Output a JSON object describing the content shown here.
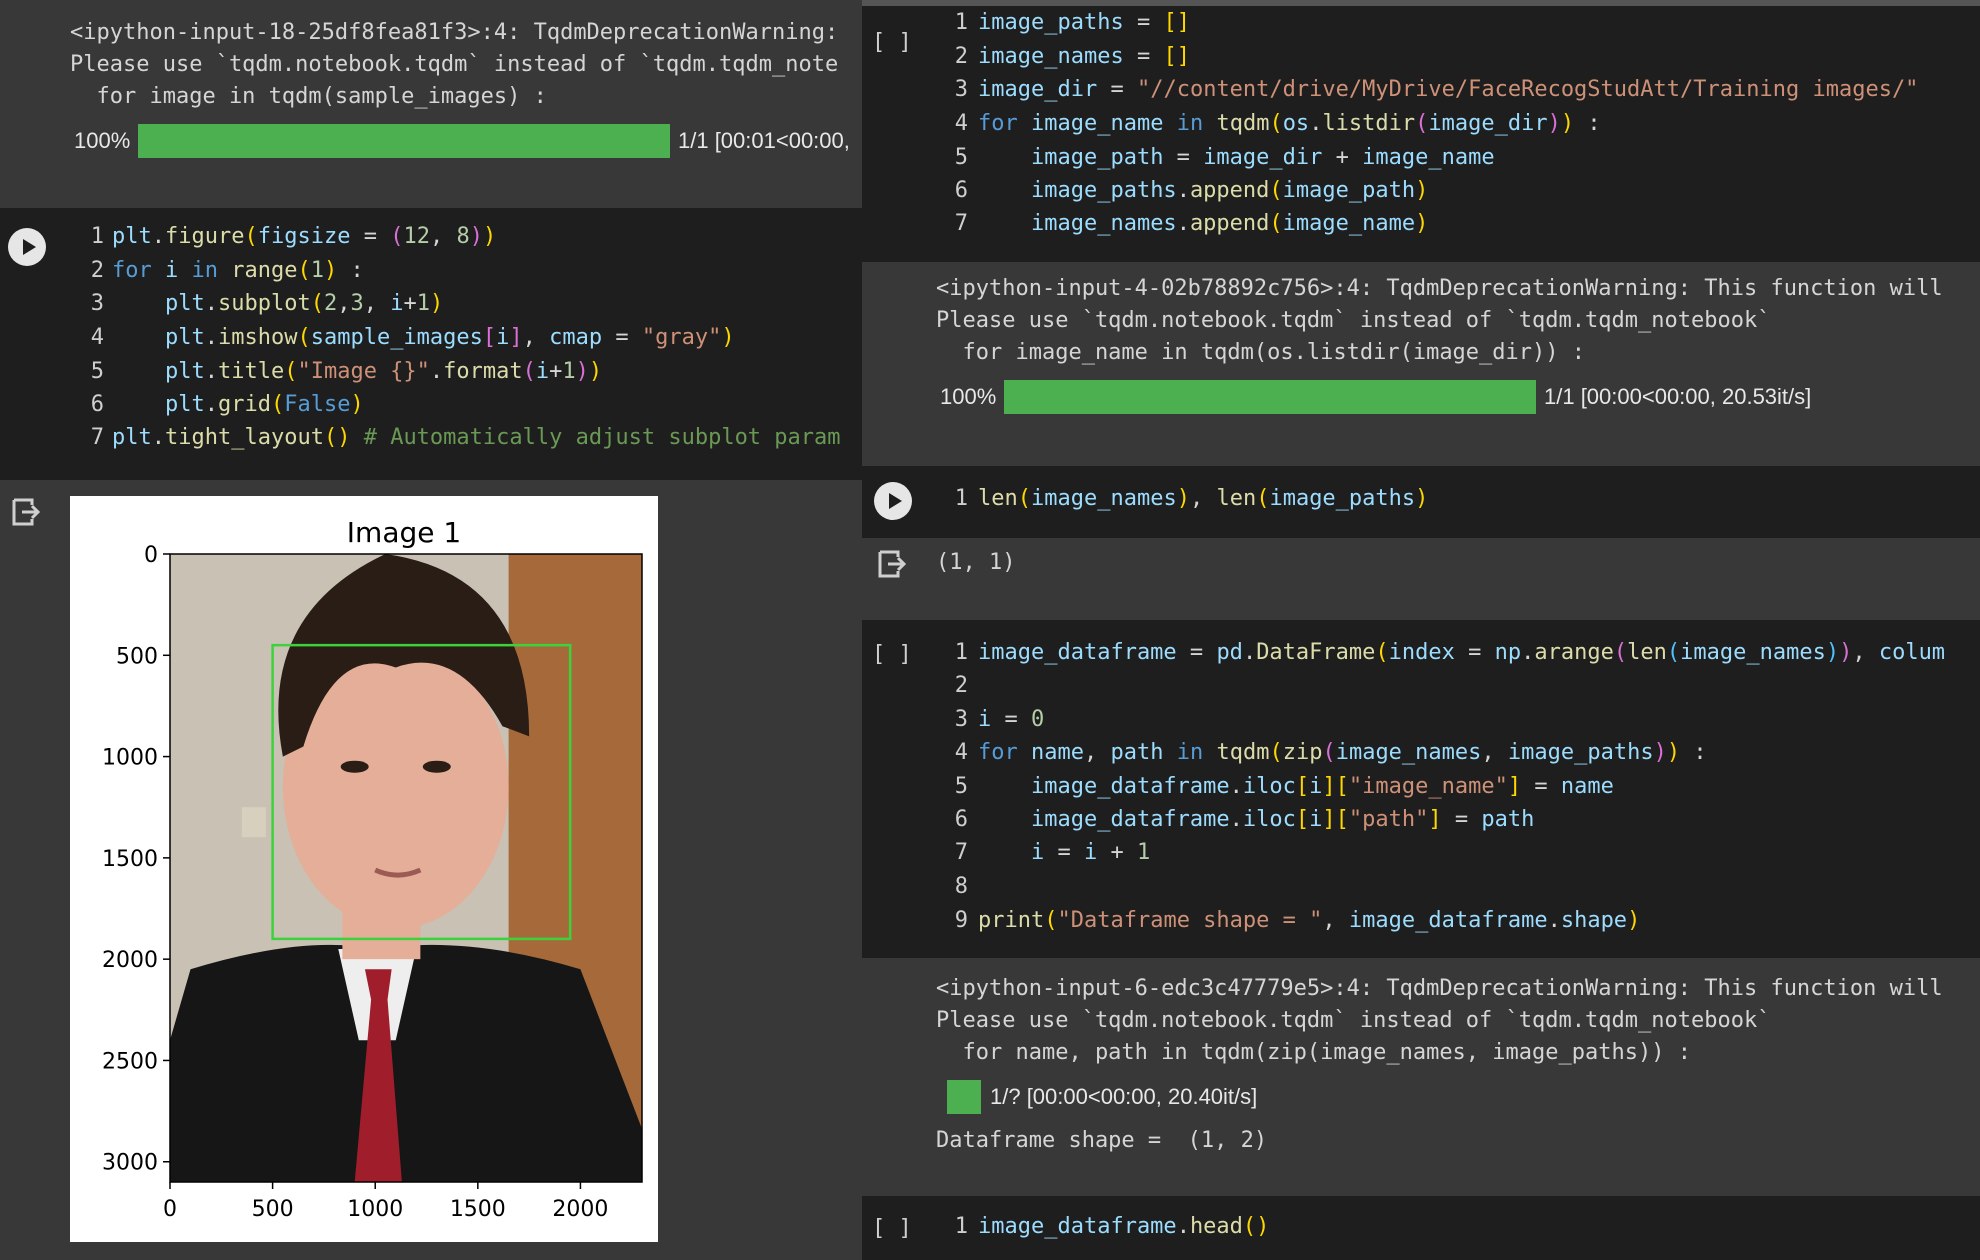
{
  "top_left_warning": {
    "line1": "<ipython-input-18-25df8fea81f3>:4: TqdmDeprecationWarning:",
    "line2": "Please use `tqdm.notebook.tqdm` instead of `tqdm.tqdm_note",
    "line3": "  for image in tqdm(sample_images) :",
    "pct": "100%",
    "progress": 1.0,
    "rate": "1/1 [00:01<00:00,"
  },
  "plot_cell": {
    "lines": [
      "plt.figure(figsize = (12, 8))",
      "for i in range(1) :",
      "    plt.subplot(2,3, i+1)",
      "    plt.imshow(sample_images[i], cmap = \"gray\")",
      "    plt.title(\"Image {}\".format(i+1))",
      "    plt.grid(False)",
      "plt.tight_layout() # Automatically adjust subplot param"
    ]
  },
  "chart_data": {
    "type": "image",
    "title": "Image 1",
    "xlim": [
      0,
      2300
    ],
    "ylim": [
      3100,
      0
    ],
    "xticks": [
      "0",
      "500",
      "1000",
      "1500",
      "2000"
    ],
    "yticks": [
      "0",
      "500",
      "1000",
      "1500",
      "2000",
      "2500",
      "3000"
    ],
    "face_box": {
      "x0": 500,
      "y0": 450,
      "x1": 1950,
      "y1": 1900,
      "color": "#3cd23c"
    },
    "colors": {
      "background": "#c8c1b4",
      "door": "#a66a3a",
      "suit": "#161616",
      "shirt": "#eeeeee",
      "tie": "#a01e2c",
      "skin": "#e4ae98",
      "hair": "#2a1d16"
    }
  },
  "cell_paths": {
    "bracket": "[ ]",
    "lines": [
      "image_paths = []",
      "image_names = []",
      "image_dir = \"//content/drive/MyDrive/FaceRecogStudAtt/Training images/\"",
      "for image_name in tqdm(os.listdir(image_dir)) :",
      "    image_path = image_dir + image_name",
      "    image_paths.append(image_path)",
      "    image_names.append(image_name)"
    ]
  },
  "warning2": {
    "line1": "<ipython-input-4-02b78892c756>:4: TqdmDeprecationWarning: This function will",
    "line2": "Please use `tqdm.notebook.tqdm` instead of `tqdm.tqdm_notebook`",
    "line3": "  for image_name in tqdm(os.listdir(image_dir)) :",
    "pct": "100%",
    "progress": 1.0,
    "rate": "1/1 [00:00<00:00, 20.53it/s]"
  },
  "len_cell": {
    "line": "len(image_names), len(image_paths)",
    "output": "(1, 1)"
  },
  "df_cell": {
    "bracket": "[ ]",
    "lines": [
      "image_dataframe = pd.DataFrame(index = np.arange(len(image_names)), colum",
      "",
      "i = 0",
      "for name, path in tqdm(zip(image_names, image_paths)) :",
      "    image_dataframe.iloc[i][\"image_name\"] = name",
      "    image_dataframe.iloc[i][\"path\"] = path",
      "    i = i + 1",
      "",
      "print(\"Dataframe shape = \", image_dataframe.shape)"
    ]
  },
  "warning3": {
    "line1": "<ipython-input-6-edc3c47779e5>:4: TqdmDeprecationWarning: This function will",
    "line2": "Please use `tqdm.notebook.tqdm` instead of `tqdm.tqdm_notebook`",
    "line3": "  for name, path in tqdm(zip(image_names, image_paths)) :",
    "rate": "1/? [00:00<00:00, 20.40it/s]",
    "shape": "Dataframe shape =  (1, 2)"
  },
  "head_cell": {
    "bracket": "[ ]",
    "line": "image_dataframe.head()"
  }
}
